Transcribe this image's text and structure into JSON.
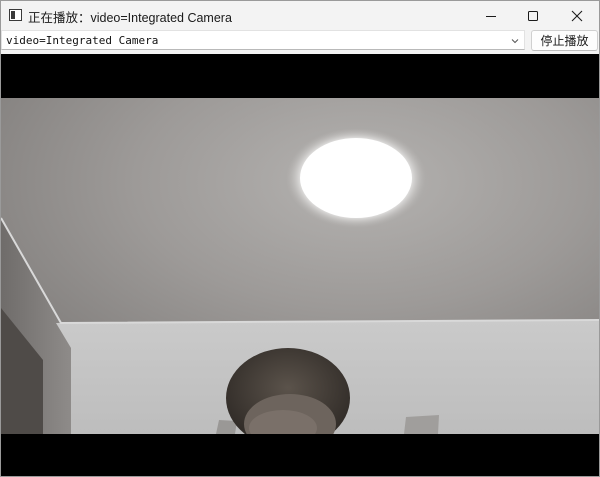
{
  "window": {
    "title": "正在播放：video=Integrated Camera",
    "icon": "app-window-icon",
    "controls": [
      "minimize-icon",
      "maximize-icon",
      "close-icon"
    ]
  },
  "toolbar": {
    "source_select": {
      "value": "video=Integrated Camera"
    },
    "stop_button_label": "停止播放"
  },
  "video": {
    "content": "camera-feed"
  },
  "colors": {
    "titlebar_bg": "#f3f3f3",
    "video_bg": "#000000",
    "ceiling": "#9b9896",
    "wall": "#cfcfcf"
  }
}
